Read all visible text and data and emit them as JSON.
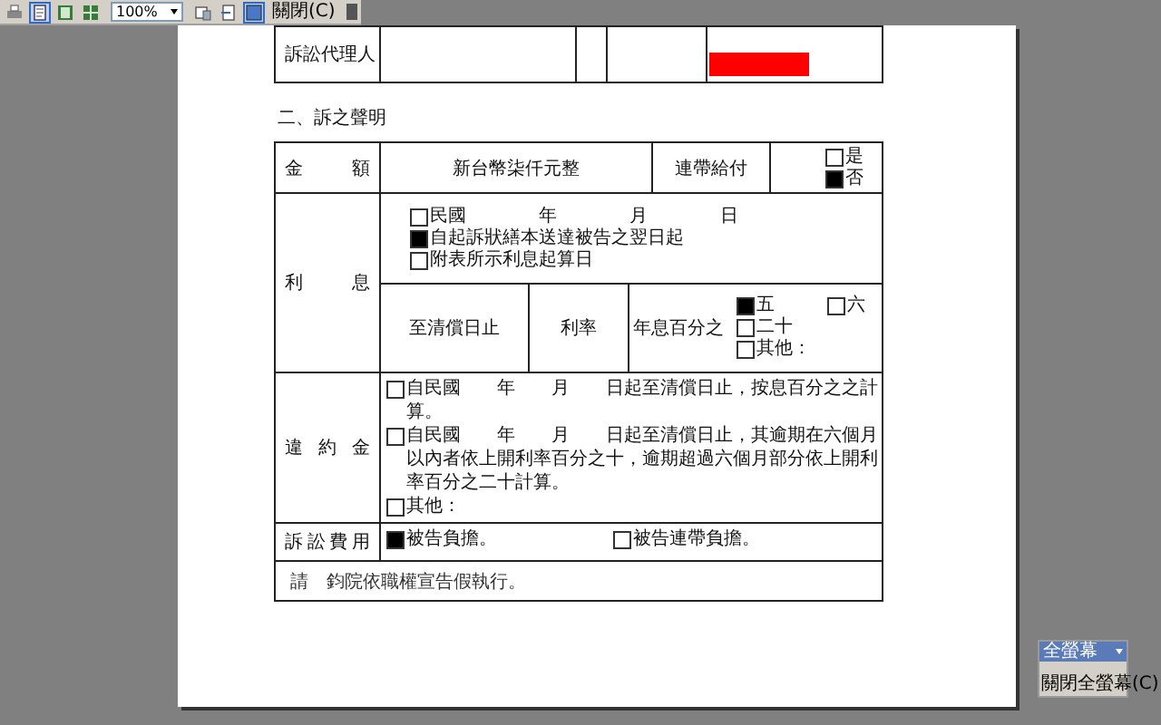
{
  "toolbar": {
    "items": [
      {
        "kind": "print",
        "selected": false
      },
      {
        "kind": "single-page",
        "selected": true
      },
      {
        "kind": "two-page",
        "selected": false
      },
      {
        "kind": "multi-page",
        "selected": false
      },
      {
        "kind": "zoom",
        "value": "100%"
      },
      {
        "kind": "page-setup",
        "selected": false
      },
      {
        "kind": "fit",
        "selected": false
      },
      {
        "kind": "fullscreen",
        "selected": true
      },
      {
        "kind": "close",
        "label": "關閉(C)"
      }
    ]
  },
  "document": {
    "agent_row": {
      "label": "訴訟代理人"
    },
    "section_heading": "二、訴之聲明",
    "amount": {
      "label": "金額",
      "value": "新台幣柒仟元整",
      "joint_label": "連帶給付",
      "options": [
        {
          "label": "是",
          "checked": false
        },
        {
          "label": "否",
          "checked": true
        }
      ]
    },
    "interest": {
      "label": "利息",
      "start_options": [
        {
          "label": "民國　　　　年　　　　月　　　　日",
          "checked": false
        },
        {
          "label": "自起訴狀繕本送達被告之翌日起",
          "checked": true
        },
        {
          "label": "附表所示利息起算日",
          "checked": false
        }
      ],
      "until": "至清償日止",
      "rate_label": "利率",
      "rate_prefix": "年息百分之",
      "rate_options": [
        {
          "label": "五",
          "checked": true
        },
        {
          "label": "六",
          "checked": false
        },
        {
          "label": "二十",
          "checked": false
        },
        {
          "label": "其他：",
          "checked": false
        }
      ]
    },
    "penalty": {
      "label": "違約金",
      "options": [
        {
          "label": "自民國　　年　　月　　日起至清償日止，按息百分之之計算。",
          "checked": false
        },
        {
          "label": "自民國　　年　　月　　日起至清償日止，其逾期在六個月以內者依上開利率百分之十，逾期超過六個月部分依上開利率百分之二十計算。",
          "checked": false
        },
        {
          "label": "其他：",
          "checked": false
        }
      ]
    },
    "costs": {
      "label": "訴訟費用",
      "options": [
        {
          "label": "被告負擔。",
          "checked": true
        },
        {
          "label": "被告連帶負擔。",
          "checked": false
        }
      ]
    },
    "request": "請　鈞院依職權宣告假執行。"
  },
  "fullscreen_bar": {
    "title": "全螢幕",
    "button": "關閉全螢幕(C)"
  }
}
